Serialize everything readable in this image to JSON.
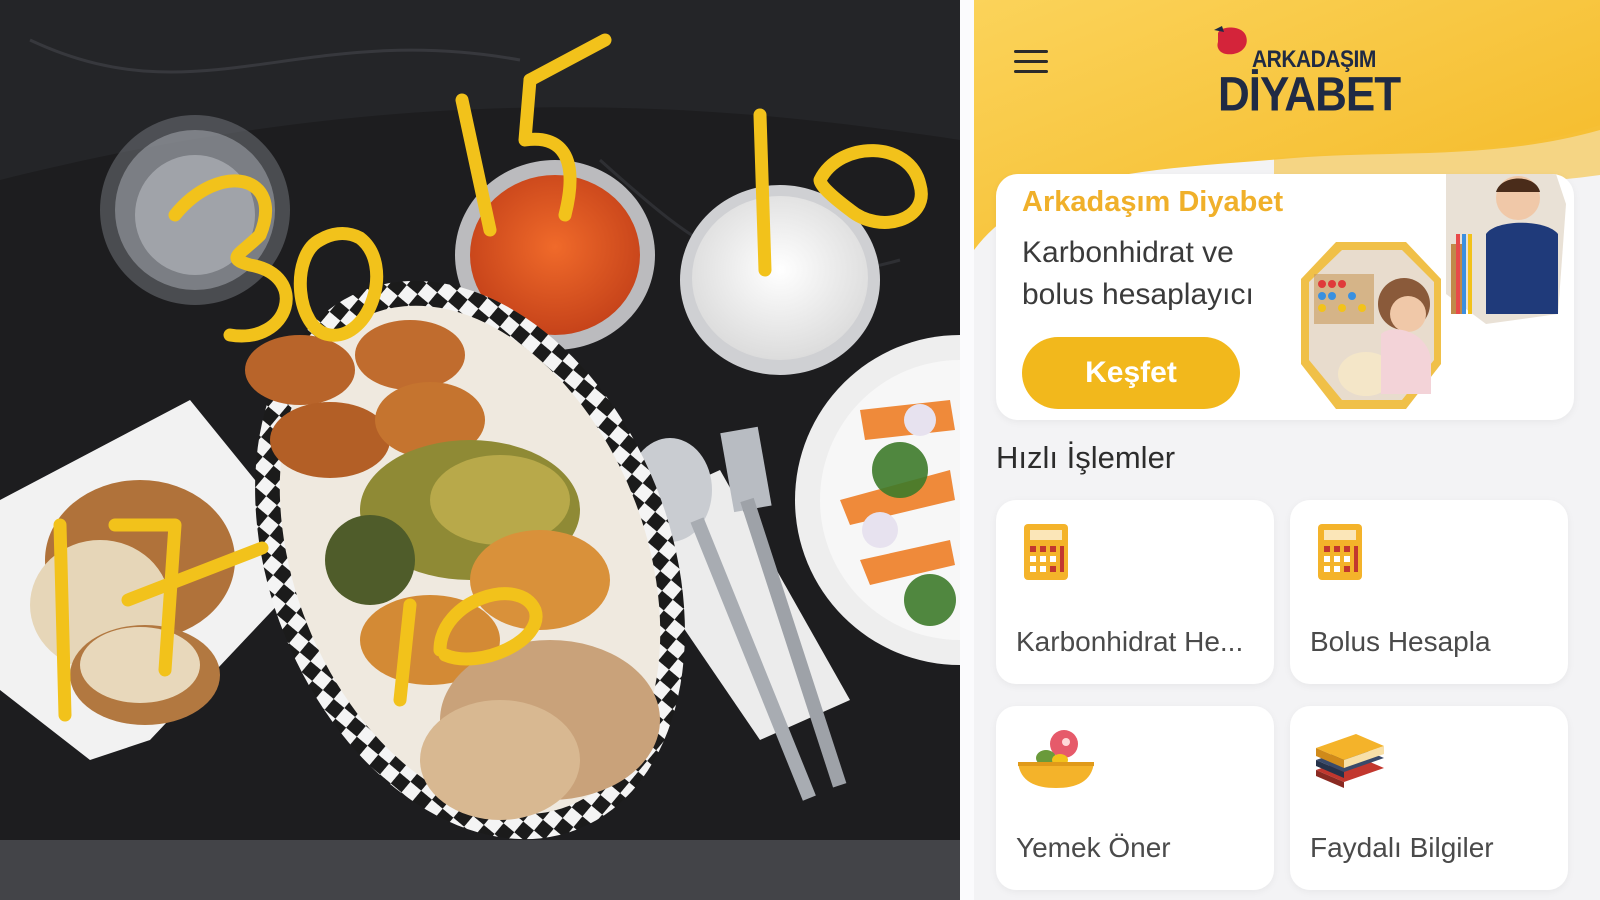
{
  "photo": {
    "handwritten_annotations": [
      "30",
      "15",
      "10",
      "17",
      "10"
    ],
    "annotation_color": "#f2c21b"
  },
  "app": {
    "brand_color": "#f2b81c",
    "header": {
      "menu_icon": "hamburger-menu-icon",
      "logo_text_top": "ARKADAŞIM",
      "logo_text_bottom": "DİYABET"
    },
    "hero": {
      "title": "Arkadaşım Diyabet",
      "subtitle_line1": "Karbonhidrat ve",
      "subtitle_line2": "bolus hesaplayıcı",
      "button_label": "Keşfet"
    },
    "quick_actions": {
      "title": "Hızlı İşlemler",
      "items": [
        {
          "label": "Karbonhidrat He...",
          "icon": "calculator-icon"
        },
        {
          "label": "Bolus Hesapla",
          "icon": "calculator-icon"
        },
        {
          "label": "Yemek Öner",
          "icon": "food-bowl-icon"
        },
        {
          "label": "Faydalı Bilgiler",
          "icon": "books-icon"
        }
      ]
    }
  }
}
